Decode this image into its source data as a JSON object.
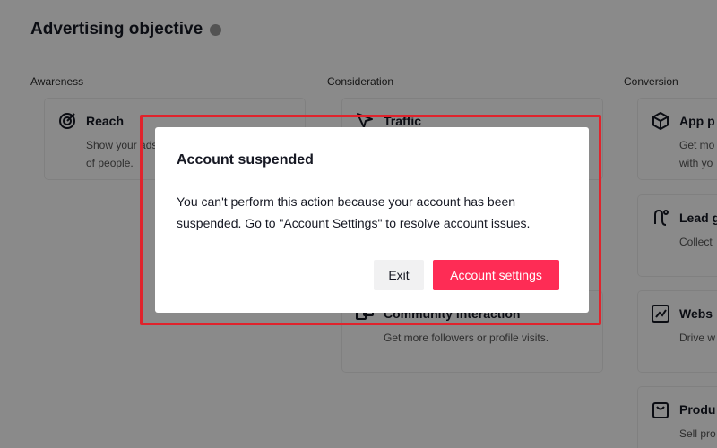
{
  "page": {
    "title": "Advertising objective"
  },
  "columns": [
    {
      "label": "Awareness",
      "cards": [
        {
          "icon": "target-icon",
          "title": "Reach",
          "description": "Show your ads to the maximum number of people."
        }
      ]
    },
    {
      "label": "Consideration",
      "cards": [
        {
          "icon": "cursor-icon",
          "title": "Traffic",
          "description": ""
        },
        {
          "icon": "community-icon",
          "title": "Community interaction",
          "description": "Get more followers or profile visits."
        }
      ]
    },
    {
      "label": "Conversion",
      "cards": [
        {
          "icon": "cube-icon",
          "title": "App p",
          "description": "Get mo with yo"
        },
        {
          "icon": "lead-icon",
          "title": "Lead g",
          "description": "Collect"
        },
        {
          "icon": "trend-icon",
          "title": "Webs",
          "description": "Drive w"
        },
        {
          "icon": "bag-icon",
          "title": "Produ",
          "description": "Sell pro"
        }
      ]
    }
  ],
  "modal": {
    "title": "Account suspended",
    "body": "You can't perform this action because your account has been suspended. Go to \"Account Settings\" to resolve account issues.",
    "exit_label": "Exit",
    "primary_label": "Account settings"
  },
  "colors": {
    "accent": "#fe2c55",
    "highlight_border": "#e0232c",
    "overlay": "rgba(0,0,0,0.46)"
  }
}
